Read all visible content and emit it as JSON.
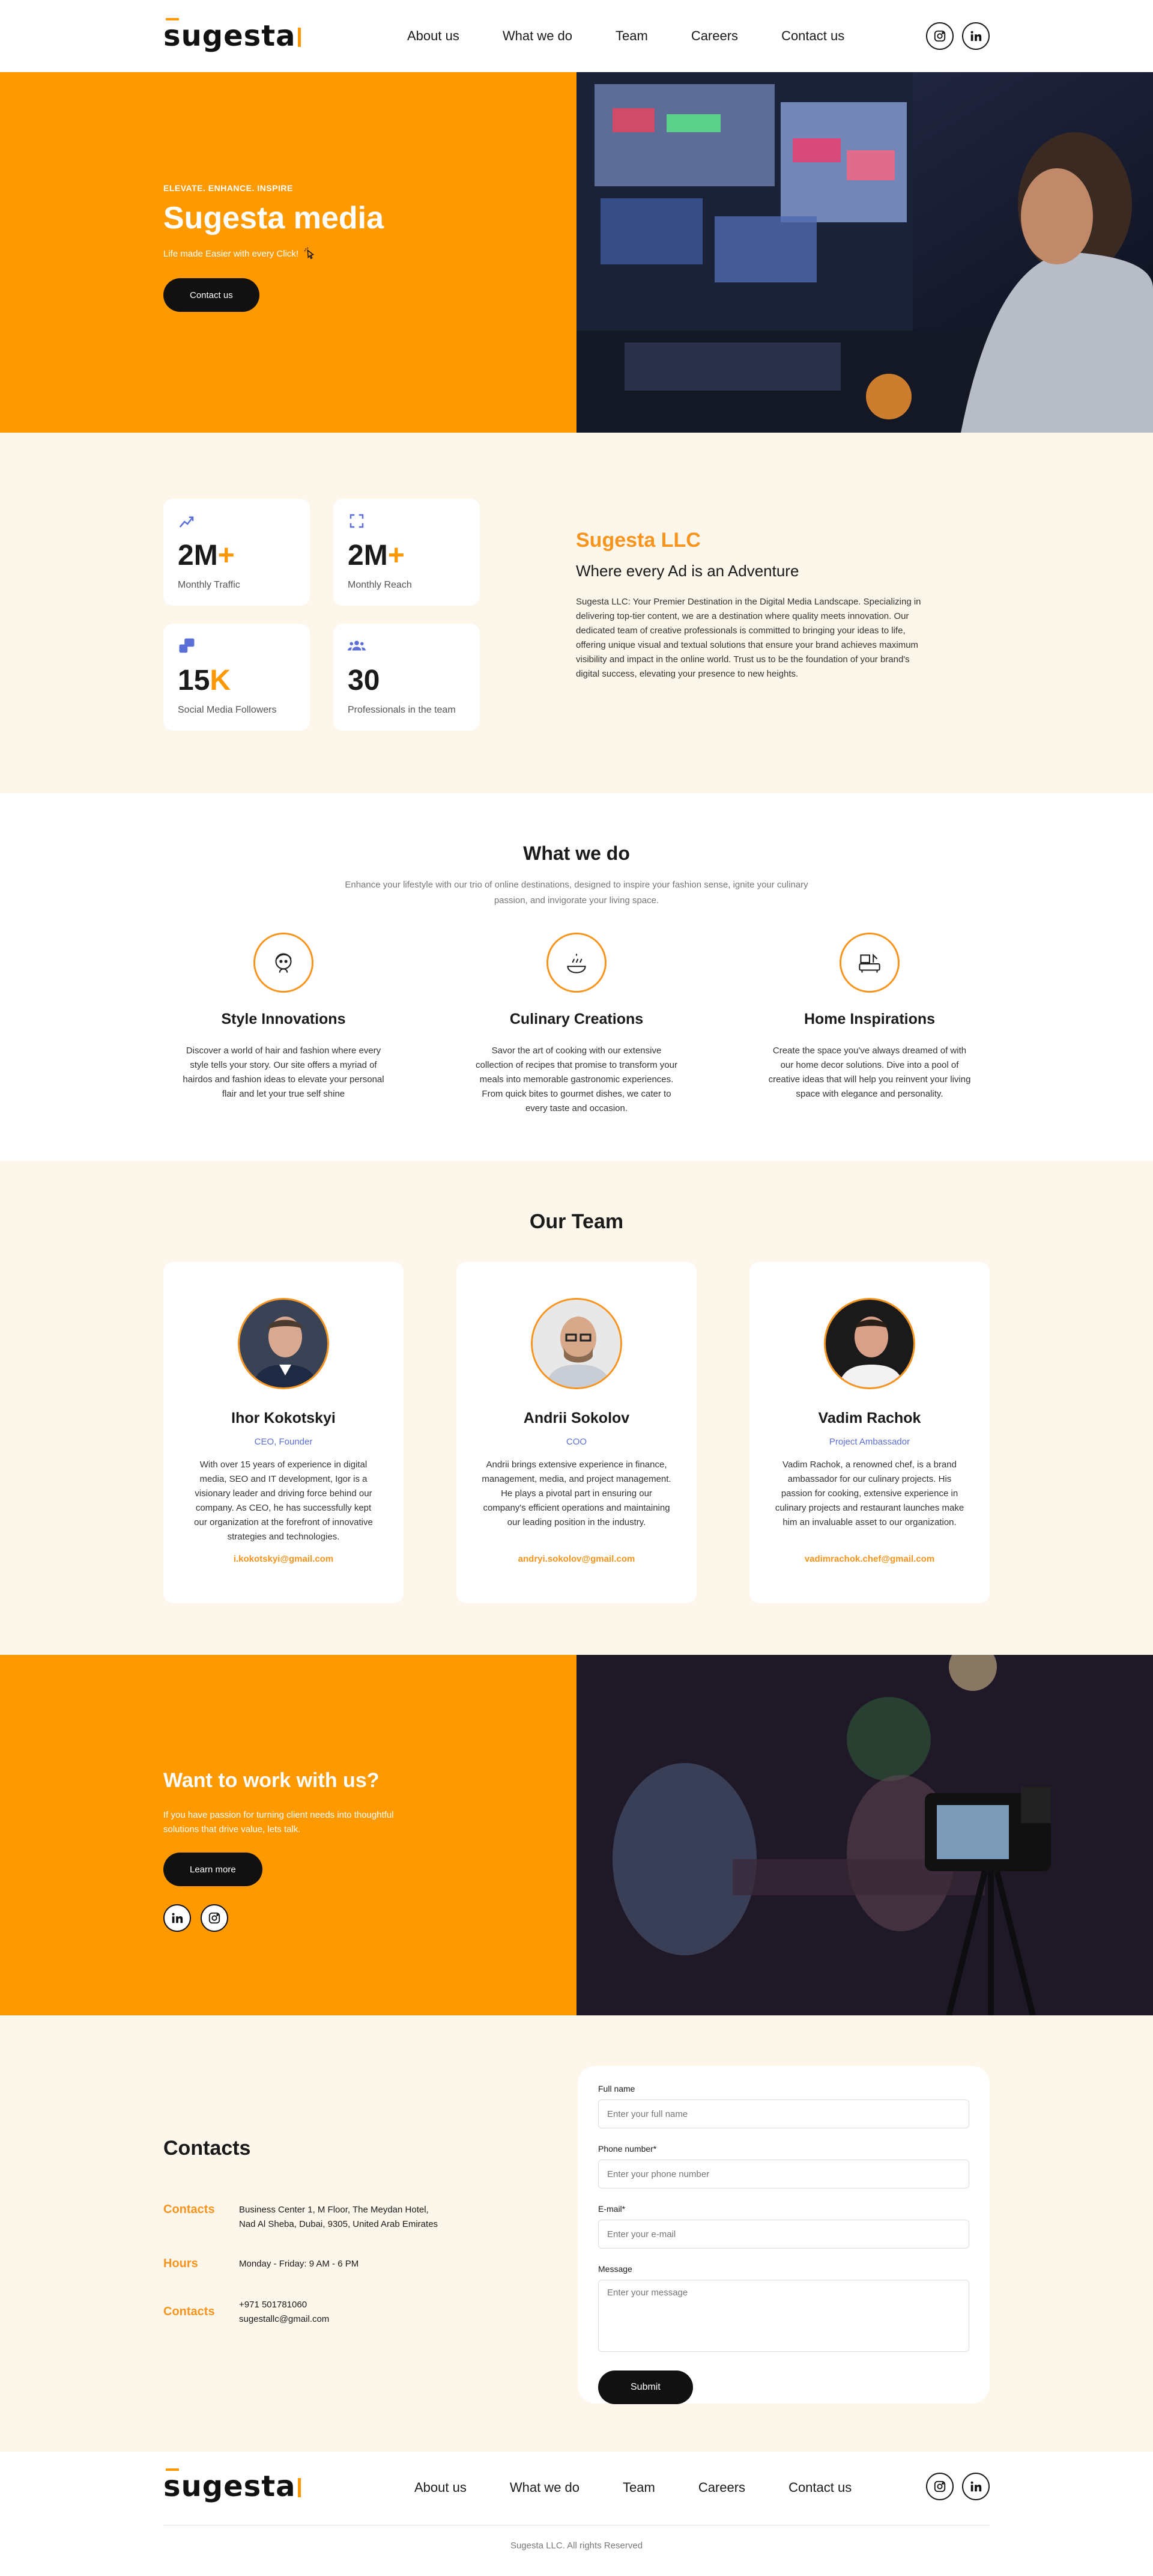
{
  "header": {
    "logo": "sugesta",
    "nav": [
      "About us",
      "What we do",
      "Team",
      "Careers",
      "Contact us"
    ],
    "social": [
      "instagram-icon",
      "linkedin-icon"
    ]
  },
  "hero": {
    "eyebrow": "ELEVATE. ENHANCE. INSPIRE",
    "title": "Sugesta media",
    "tagline": "Life made Easier with every Click!",
    "button": "Contact us"
  },
  "stats": [
    {
      "value": "2M",
      "suffix": "+",
      "label": "Monthly Traffic",
      "icon": "chart-icon"
    },
    {
      "value": "2M",
      "suffix": "+",
      "label": "Monthly Reach",
      "icon": "expand-icon"
    },
    {
      "value": "15",
      "suffix": "K",
      "label": "Social Media Followers",
      "icon": "social-icon"
    },
    {
      "value": "30",
      "suffix": "",
      "label": "Professionals in the team",
      "icon": "team-icon"
    }
  ],
  "about": {
    "company": "Sugesta LLC",
    "headline": "Where every Ad is an Adventure",
    "body": "Sugesta LLC: Your Premier Destination in the Digital Media Landscape. Specializing in delivering top-tier content, we are a destination where quality meets innovation. Our dedicated team of creative professionals is committed to bringing your ideas to life, offering unique visual and textual solutions that ensure your brand achieves maximum visibility and impact in the online world. Trust us to be the foundation of your brand's digital success, elevating your presence to new heights."
  },
  "what": {
    "title": "What we do",
    "subtitle": "Enhance your lifestyle with our trio of online destinations, designed to inspire your fashion sense, ignite your culinary passion, and invigorate your living space.",
    "services": [
      {
        "title": "Style Innovations",
        "icon": "hairstyle-icon",
        "text": "Discover a world of hair and fashion where every style tells your story. Our site offers a myriad of hairdos and fashion ideas to elevate your personal flair and let your true self shine"
      },
      {
        "title": "Culinary Creations",
        "icon": "cooking-icon",
        "text": "Savor the art of cooking with our extensive collection of recipes that promise to transform your meals into memorable gastronomic experiences. From quick bites to gourmet dishes, we cater to every taste and occasion."
      },
      {
        "title": "Home Inspirations",
        "icon": "home-decor-icon",
        "text": "Create the space you've always dreamed of with our home decor solutions. Dive into a pool of creative ideas that will help you reinvent your living space with elegance and personality."
      }
    ]
  },
  "team": {
    "title": "Our Team",
    "members": [
      {
        "name": "Ihor Kokotskyi",
        "role": "CEO, Founder",
        "bio": "With over 15 years of experience in digital media, SEO and IT development, Igor is a visionary leader and driving force behind our company. As CEO, he has successfully kept our organization at the forefront of innovative strategies and technologies.",
        "email": "i.kokotskyi@gmail.com"
      },
      {
        "name": "Andrii Sokolov",
        "role": "COO",
        "bio": "Andrii brings extensive experience in finance, management, media, and project management. He plays a pivotal part in ensuring our company's efficient operations and maintaining our leading position in the industry.",
        "email": "andryi.sokolov@gmail.com"
      },
      {
        "name": "Vadim Rachok",
        "role": "Project Ambassador",
        "bio": "Vadim Rachok, a renowned chef, is a brand ambassador for our culinary projects. His passion for cooking, extensive experience in culinary projects and restaurant launches make him an invaluable asset to our organization.",
        "email": "vadimrachok.chef@gmail.com"
      }
    ]
  },
  "cta": {
    "title": "Want to work with us?",
    "text": "If you have passion for turning client needs into thoughtful solutions that drive value, lets talk.",
    "button": "Learn more"
  },
  "contacts": {
    "title": "Contacts",
    "rows": [
      {
        "key": "Contacts",
        "lines": [
          "Business Center 1, M Floor, The Meydan Hotel,",
          "Nad Al Sheba, Dubai, 9305, United Arab Emirates"
        ]
      },
      {
        "key": "Hours",
        "lines": [
          "Monday - Friday: 9 AM - 6 PM"
        ]
      },
      {
        "key": "Contacts",
        "lines": [
          "+971 501781060",
          "sugestallc@gmail.com"
        ]
      }
    ]
  },
  "form": {
    "name_label": "Full name",
    "name_ph": "Enter your full name",
    "phone_label": "Phone number*",
    "phone_ph": "Enter your phone number",
    "email_label": "E-mail*",
    "email_ph": "Enter your e-mail",
    "msg_label": "Message",
    "msg_ph": "Enter your message",
    "submit": "Submit"
  },
  "footer": {
    "copyright": "Sugesta LLC. All rights Reserved"
  },
  "colors": {
    "accent": "#ff9900",
    "dark": "#111111",
    "role": "#5b6fd6",
    "cream": "#fdf6ea"
  }
}
